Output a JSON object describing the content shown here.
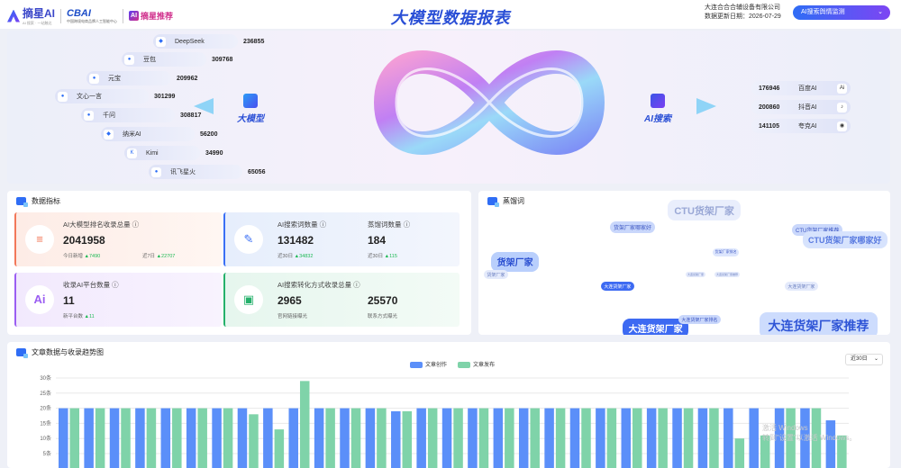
{
  "header": {
    "logo_main": "摘星AI",
    "logo_main_sub": "AI 搜索  ·  一站触达",
    "logo_cbai": "CBAI",
    "logo_cbai_sub": "中国跨境电商品牌人工智能中心",
    "logo_secondary": "摘星推荐",
    "title": "大模型数据报表",
    "company": "大连合合合辅设备有限公司",
    "updated": "数据更新日期：2026-07-29",
    "ai_button": "AI搜索舆情监测"
  },
  "hero": {
    "left_label": "大模型",
    "right_label": "AI搜索",
    "models": [
      {
        "name": "DeepSeek",
        "value": "236855"
      },
      {
        "name": "豆包",
        "value": "309768"
      },
      {
        "name": "元宝",
        "value": "209962"
      },
      {
        "name": "文心一言",
        "value": "301299"
      },
      {
        "name": "千问",
        "value": "308817"
      },
      {
        "name": "纳米AI",
        "value": "56200"
      },
      {
        "name": "Kimi",
        "value": "34990"
      },
      {
        "name": "讯飞星火",
        "value": "65056"
      }
    ],
    "search": [
      {
        "value": "176946",
        "name": "百度AI"
      },
      {
        "value": "200860",
        "name": "抖音AI"
      },
      {
        "value": "141105",
        "name": "夸克AI"
      }
    ]
  },
  "metrics": {
    "title": "数据指标",
    "cards": [
      {
        "label": "AI大模型排名收录总量 ⓘ",
        "value": "2041958",
        "sub1_label": "今日新增",
        "sub1": "7490",
        "sub2_label": "近7日",
        "sub2": "22707"
      },
      {
        "label": "AI搜索词数量 ⓘ",
        "value": "131482",
        "sub1_label": "近30日",
        "sub1": "34832",
        "label2": "蒸馏词数量 ⓘ",
        "value2": "184",
        "sub2_label": "近30日",
        "sub2": "115"
      },
      {
        "label": "收录AI平台数量 ⓘ",
        "value": "11",
        "sub1_label": "新平台数",
        "sub1": "11"
      },
      {
        "label": "AI搜索转化方式收录总量 ⓘ",
        "value": "2965",
        "sub1_label": "官网链接曝光",
        "value2": "25570",
        "sub2_label": "联系方式曝光"
      }
    ]
  },
  "keywords": {
    "title": "蒸馏词",
    "items": [
      {
        "text": "CTU货架厂家"
      },
      {
        "text": "货架厂家哪家好"
      },
      {
        "text": "CTU货架厂家推荐"
      },
      {
        "text": "CTU货架厂家哪家好"
      },
      {
        "text": "货架厂家"
      },
      {
        "text": "货架厂家"
      },
      {
        "text": "货架厂家排名"
      },
      {
        "text": "大连货架厂家"
      },
      {
        "text": "大连货架厂家"
      },
      {
        "text": "大连货架厂家推荐"
      },
      {
        "text": "大连货架厂家"
      },
      {
        "text": "大连货架厂家排名"
      },
      {
        "text": "大连货架厂家推荐"
      },
      {
        "text": "大连货架厂家"
      }
    ]
  },
  "trend": {
    "title": "文章数据与收录趋势图",
    "range": "近30日",
    "watermark_line1": "激活 Windows",
    "watermark_line2": "转到\"设置\"以激活 Windows。"
  },
  "chart_data": {
    "type": "bar",
    "title": "文章数据与收录趋势图",
    "y_ticks": [
      "30条",
      "25条",
      "20条",
      "15条",
      "10条",
      "5条"
    ],
    "ylim": [
      0,
      30
    ],
    "series": [
      {
        "name": "文章创作",
        "color": "#5b8ff9",
        "values": [
          20,
          20,
          20,
          20,
          20,
          20,
          20,
          20,
          20,
          20,
          20,
          20,
          20,
          19,
          20,
          20,
          20,
          20,
          20,
          20,
          20,
          20,
          20,
          20,
          20,
          20,
          20,
          20,
          20,
          20,
          16
        ]
      },
      {
        "name": "文章发布",
        "color": "#7fd3a9",
        "values": [
          20,
          20,
          20,
          20,
          20,
          20,
          20,
          18,
          13,
          29,
          20,
          20,
          20,
          19,
          20,
          20,
          20,
          20,
          20,
          20,
          20,
          20,
          20,
          20,
          20,
          20,
          10,
          11,
          20,
          20,
          11
        ]
      }
    ]
  }
}
